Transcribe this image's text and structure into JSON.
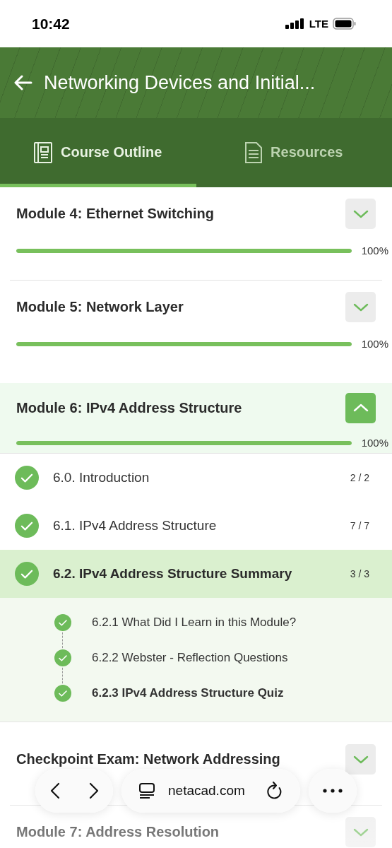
{
  "status_bar": {
    "time": "10:42",
    "network": "LTE"
  },
  "header": {
    "title": "Networking Devices and Initial..."
  },
  "tabs": [
    {
      "label": "Course Outline",
      "selected": true
    },
    {
      "label": "Resources",
      "selected": false
    }
  ],
  "modules": [
    {
      "title": "Module 4: Ethernet Switching",
      "level": 1,
      "reading": "100%",
      "expanded": false
    },
    {
      "title": "Module 5: Network Layer",
      "level": 1,
      "reading": "100%",
      "expanded": false
    },
    {
      "title": "Module 6: IPv4 Address Structure",
      "level": 1,
      "reading": "100%",
      "expanded": true,
      "lessons": [
        {
          "title": "6.0. Introduction",
          "count": "2 / 2",
          "completed": true,
          "selected": false
        },
        {
          "title": "6.1. IPv4 Address Structure",
          "count": "7 / 7",
          "completed": true,
          "selected": false
        },
        {
          "title": "6.2. IPv4 Address Structure Summary",
          "count": "3 / 3",
          "completed": true,
          "selected": true,
          "children": [
            {
              "title": "6.2.1 What Did I Learn in this Module?",
              "completed": true,
              "selected": false
            },
            {
              "title": "6.2.2 Webster - Reflection Questions",
              "completed": true,
              "selected": false
            },
            {
              "title": "6.2.3 IPv4 Address Structure Quiz",
              "completed": true,
              "selected": true
            }
          ]
        }
      ]
    },
    {
      "title": "Checkpoint Exam: Network Addressing",
      "expanded": false
    },
    {
      "title": "Module 7: Address Resolution",
      "expanded": false
    }
  ],
  "browser_bar": {
    "url": "netacad.com"
  }
}
